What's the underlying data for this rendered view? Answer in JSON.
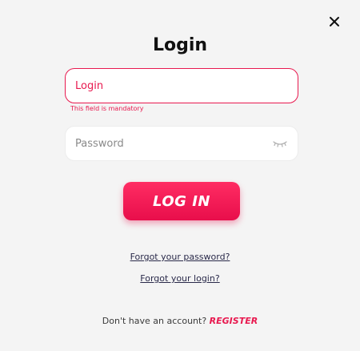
{
  "dialog": {
    "title": "Login",
    "close_icon": "close-icon"
  },
  "login_field": {
    "placeholder": "Login",
    "value": "",
    "error": "This field is mandatory"
  },
  "password_field": {
    "placeholder": "Password",
    "value": "",
    "toggle_icon": "eye-closed-icon"
  },
  "login_button": {
    "label": "LOG IN"
  },
  "links": {
    "forgot_password": "Forgot your password?",
    "forgot_login": "Forgot your login?"
  },
  "register": {
    "prompt": "Don't have an account?",
    "link_label": "REGISTER"
  },
  "colors": {
    "accent": "#e8194f",
    "background": "#f4f4f4",
    "field_background": "#ffffff",
    "title": "#111111"
  }
}
